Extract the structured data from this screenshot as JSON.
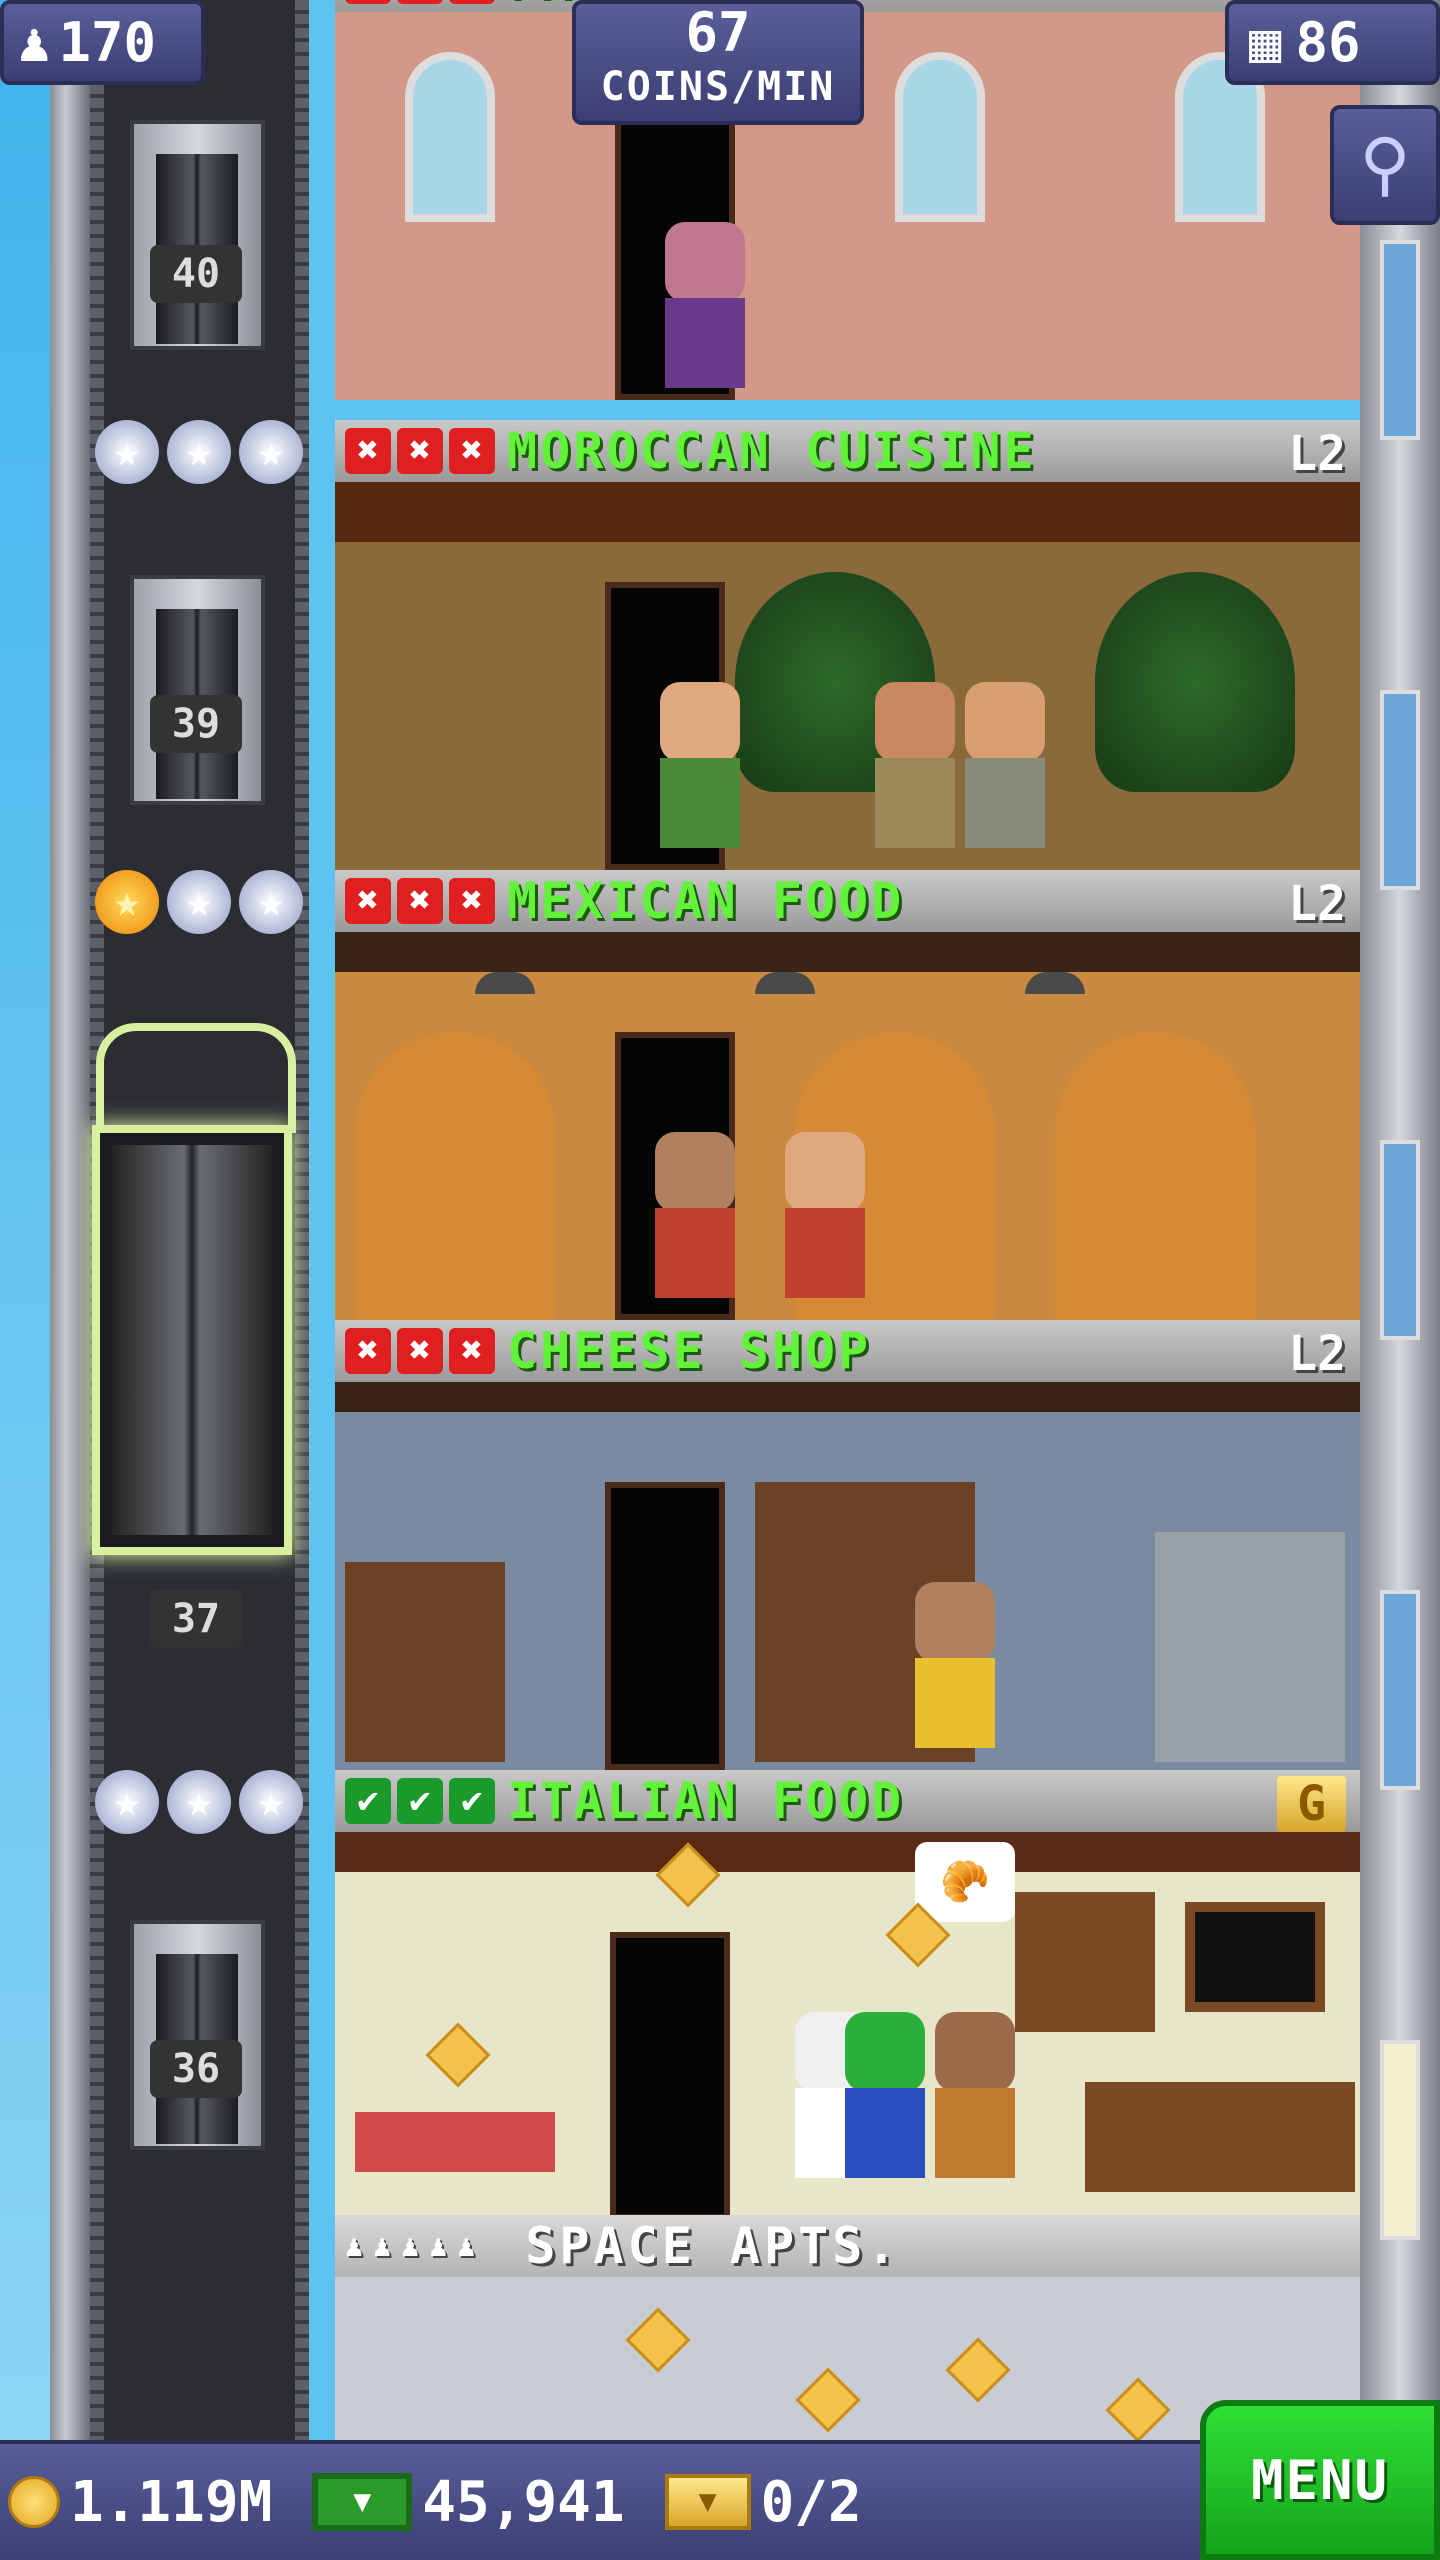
{
  "hud": {
    "population": "170",
    "coins_per_min_value": "67",
    "coins_per_min_label": "COINS/MIN",
    "total_floors": "86"
  },
  "floors": [
    {
      "title": "FANCY CUISINE",
      "title_visible": "FA          INE",
      "level": "",
      "stock": [
        "x",
        "x",
        "x"
      ]
    },
    {
      "number": "40",
      "title": "MOROCCAN CUISINE",
      "level": "L2",
      "stock": [
        "x",
        "x",
        "x"
      ],
      "stars": [
        "silver",
        "silver",
        "silver"
      ]
    },
    {
      "number": "39",
      "title": "MEXICAN FOOD",
      "level": "L2",
      "stock": [
        "x",
        "x",
        "x"
      ],
      "stars": [
        "gold",
        "silver",
        "silver"
      ]
    },
    {
      "number": "37",
      "title": "CHEESE SHOP",
      "level": "L2",
      "stock": [
        "x",
        "x",
        "x"
      ]
    },
    {
      "number": "36",
      "title": "ITALIAN FOOD",
      "level": "G",
      "stock": [
        "ok",
        "ok",
        "ok"
      ],
      "stars": [
        "silver",
        "silver",
        "silver"
      ]
    },
    {
      "title": "SPACE APTS.",
      "residents": 5
    }
  ],
  "bottom_bar": {
    "coins": "1.119M",
    "bux": "45,941",
    "tickets": "0/2",
    "menu_label": "MENU"
  },
  "icons": {
    "population": "person-icon",
    "floors": "building-icon",
    "zoom": "magnifier-icon",
    "coins": "coin-icon",
    "bux": "tower-bux-icon",
    "tickets": "golden-ticket-icon"
  },
  "colors": {
    "title_green": "#62f23a",
    "hud_blue": "#4a4f88",
    "menu_green": "#22c228",
    "stock_out_red": "#e02020",
    "stock_ok_green": "#1a9a2a"
  }
}
